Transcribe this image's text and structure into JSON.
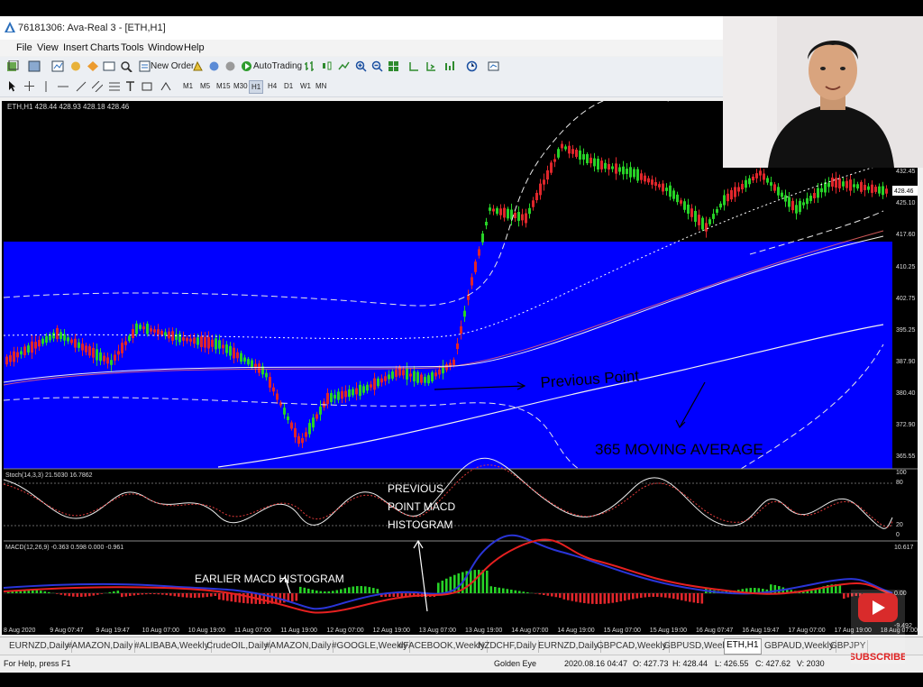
{
  "window": {
    "title": "76181306: Ava-Real 3 - [ETH,H1]"
  },
  "menu": [
    "File",
    "View",
    "Insert",
    "Charts",
    "Tools",
    "Window",
    "Help"
  ],
  "toolbar": {
    "new_order": "New Order",
    "autotrading": "AutoTrading"
  },
  "timeframes": [
    "M1",
    "M5",
    "M15",
    "M30",
    "H1",
    "H4",
    "D1",
    "W1",
    "MN"
  ],
  "active_timeframe": "H1",
  "chart": {
    "header": "ETH,H1  428.44 428.93 428.18 428.46",
    "price_labels": [
      "432.45",
      "425.10",
      "417.60",
      "410.25",
      "402.75",
      "395.25",
      "387.90",
      "380.40",
      "372.90",
      "365.55"
    ],
    "current_price": "428.46",
    "time_labels": [
      "8 Aug 2020",
      "9 Aug 07:47",
      "9 Aug 19:47",
      "10 Aug 07:00",
      "10 Aug 19:00",
      "11 Aug 07:00",
      "11 Aug 19:00",
      "12 Aug 07:00",
      "12 Aug 19:00",
      "13 Aug 07:00",
      "13 Aug 19:00",
      "14 Aug 07:00",
      "14 Aug 19:00",
      "15 Aug 07:00",
      "15 Aug 19:00",
      "16 Aug 07:47",
      "16 Aug 19:47",
      "17 Aug 07:00",
      "17 Aug 19:00",
      "18 Aug 07:00"
    ],
    "stoch_header": "Stoch(14,3,3) 21.5030 16.7862",
    "stoch_levels": [
      "100",
      "80",
      "20",
      "0"
    ],
    "macd_header": "MACD(12,26,9) -0.363 0.598 0.000 -0.961",
    "macd_levels": [
      "10.617",
      "0.00",
      "-9.492"
    ]
  },
  "annotations": {
    "previous_point": "Previous Point",
    "moving_average": "365 MOVING AVERAGE",
    "prev_macd_hist": [
      "PREVIOUS",
      "POINT MACD",
      "HISTOGRAM"
    ],
    "earlier_macd": "EARLIER MACD HISTOGRAM"
  },
  "tabs": [
    "EURNZD,Daily",
    "#AMAZON,Daily",
    "#ALIBABA,Weekly",
    "CrudeOIL,Daily",
    "#AMAZON,Daily",
    "#GOOGLE,Weekly",
    "#FACEBOOK,Weekly",
    "NZDCHF,Daily",
    "EURNZD,Daily",
    "GBPCAD,Weekly",
    "GBPUSD,Weekly",
    "ETH,H1",
    "GBPAUD,Weekly",
    "GBPJPY"
  ],
  "active_tab": "ETH,H1",
  "status": {
    "help": "For Help, press F1",
    "profile": "Golden Eye",
    "datetime": "2020.08.16 04:47",
    "open": "O: 427.73",
    "high": "H: 428.44",
    "low": "L: 426.55",
    "close": "C: 427.62",
    "volume": "V: 2030"
  },
  "overlay": {
    "subscribe": "SUBSCRIBE"
  },
  "colors": {
    "chart_bg": "#000000",
    "highlight": "#0000ff",
    "bull": "#27d327",
    "bear": "#e0262b",
    "macd_line": "#2a35d8",
    "signal_line": "#e62020"
  },
  "icons": [
    "app-icon",
    "arrow-cursor-icon",
    "crosshair-icon",
    "new-order-icon",
    "autotrading-icon",
    "zoom-in-icon",
    "zoom-out-icon",
    "youtube-play-icon"
  ]
}
